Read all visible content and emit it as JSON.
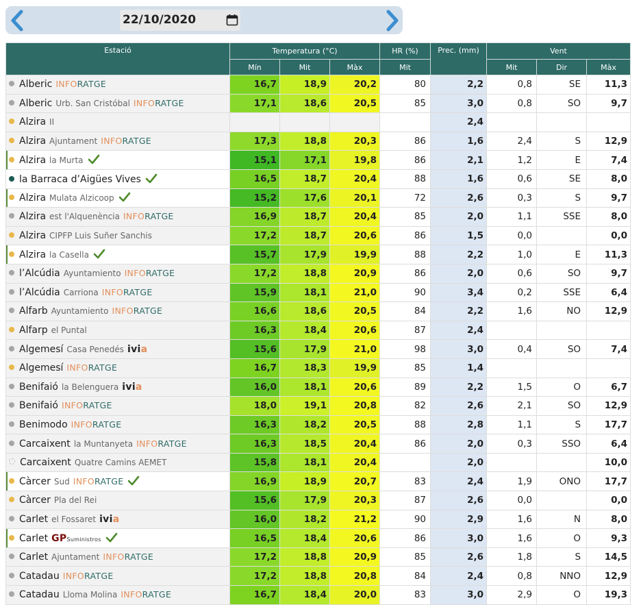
{
  "date_picker": {
    "value": "22/10/2020"
  },
  "nav": {
    "prev_icon": "chevron-left-icon",
    "next_icon": "chevron-right-icon"
  },
  "colors": {
    "header": "#2e6b67",
    "arrow": "#3b8ed0",
    "prec_bg": "#dde6f3",
    "check": "#4d8a2a"
  },
  "table": {
    "group_headers": {
      "station": "Estació",
      "temp": "Temperatura (°C)",
      "hr": "HR (%)",
      "prec": "Prec. (mm)",
      "wind": "Vent"
    },
    "sub_headers": {
      "tmin": "Mín",
      "tmit": "Mit",
      "tmax": "Màx",
      "hrmit": "Mit",
      "wmit": "Mit",
      "wdir": "Dir",
      "wmax": "Màx"
    },
    "rows": [
      {
        "town": "Alberic",
        "sub": "",
        "network": "INFORATGE",
        "dot": "grey",
        "check": false,
        "tmin": "16,7",
        "tmit": "18,9",
        "tmax": "20,2",
        "cmin": "#7ed321",
        "cmit": "#c6ef26",
        "cmax": "#eef524",
        "hr": "80",
        "prec": "2,2",
        "wmit": "0,8",
        "wdir": "SE",
        "wmax": "11,3"
      },
      {
        "town": "Alberic",
        "sub": "Urb. San Cristóbal",
        "network": "INFORATGE",
        "dot": "grey",
        "check": false,
        "tmin": "17,1",
        "tmit": "18,6",
        "tmax": "20,5",
        "cmin": "#8ad92a",
        "cmit": "#b9ea2e",
        "cmax": "#f1f721",
        "hr": "85",
        "prec": "3,0",
        "wmit": "0,8",
        "wdir": "SO",
        "wmax": "9,7"
      },
      {
        "town": "Alzira",
        "sub": "II",
        "network": "",
        "dot": "yellow",
        "check": false,
        "tmin": "",
        "tmit": "",
        "tmax": "",
        "cmin": "",
        "cmit": "",
        "cmax": "",
        "hr": "",
        "prec": "2,4",
        "wmit": "",
        "wdir": "",
        "wmax": ""
      },
      {
        "town": "Alzira",
        "sub": "Ajuntament",
        "network": "INFORATGE",
        "dot": "yellow",
        "check": false,
        "tmin": "17,3",
        "tmit": "18,8",
        "tmax": "20,3",
        "cmin": "#8ed92c",
        "cmit": "#c1ed2a",
        "cmax": "#eff523",
        "hr": "86",
        "prec": "1,6",
        "wmit": "2,4",
        "wdir": "S",
        "wmax": "12,9"
      },
      {
        "town": "Alzira",
        "sub": "la Murta",
        "network": "",
        "dot": "yellow",
        "check": true,
        "marked": true,
        "white": true,
        "tmin": "15,1",
        "tmit": "17,1",
        "tmax": "19,8",
        "cmin": "#3fb824",
        "cmit": "#86d72a",
        "cmax": "#e7f326",
        "hr": "86",
        "prec": "2,1",
        "wmit": "1,2",
        "wdir": "E",
        "wmax": "7,4"
      },
      {
        "town": "la Barraca d’Aigües Vives",
        "sub": "",
        "network": "",
        "dot": "teal",
        "check": true,
        "white": true,
        "tmin": "16,5",
        "tmit": "18,7",
        "tmax": "20,4",
        "cmin": "#78d025",
        "cmit": "#c1ed2a",
        "cmax": "#f0f622",
        "hr": "88",
        "prec": "1,6",
        "wmit": "0,6",
        "wdir": "SE",
        "wmax": "8,0"
      },
      {
        "town": "Alzira",
        "sub": "Mulata Alzicoop",
        "network": "",
        "dot": "yellow",
        "check": true,
        "marked": true,
        "white": true,
        "tmin": "15,2",
        "tmit": "17,6",
        "tmax": "20,1",
        "cmin": "#45ba24",
        "cmit": "#9de02b",
        "cmax": "#ecf424",
        "hr": "72",
        "prec": "2,6",
        "wmit": "0,3",
        "wdir": "S",
        "wmax": "9,7"
      },
      {
        "town": "Alzira",
        "sub": "est l'Alquenència",
        "network": "INFORATGE",
        "dot": "grey",
        "check": false,
        "tmin": "16,9",
        "tmit": "18,7",
        "tmax": "20,4",
        "cmin": "#84d528",
        "cmit": "#bdeb2c",
        "cmax": "#f0f622",
        "hr": "85",
        "prec": "2,0",
        "wmit": "1,1",
        "wdir": "SSE",
        "wmax": "8,0"
      },
      {
        "town": "Alzira",
        "sub": "CIPFP Luis Suñer Sanchis",
        "network": "",
        "dot": "yellow",
        "check": false,
        "tmin": "17,2",
        "tmit": "18,7",
        "tmax": "20,6",
        "cmin": "#8ad92a",
        "cmit": "#bdeb2c",
        "cmax": "#f2f721",
        "hr": "86",
        "prec": "1,5",
        "wmit": "0,0",
        "wdir": "",
        "wmax": "0,0"
      },
      {
        "town": "Alzira",
        "sub": "la Casella",
        "network": "",
        "dot": "yellow",
        "check": true,
        "marked": true,
        "white": true,
        "tmin": "15,7",
        "tmit": "17,9",
        "tmax": "19,9",
        "cmin": "#58c126",
        "cmit": "#a8e42d",
        "cmax": "#e1f127",
        "hr": "88",
        "prec": "2,2",
        "wmit": "1,0",
        "wdir": "E",
        "wmax": "11,3"
      },
      {
        "town": "l’Alcúdia",
        "sub": "Ayuntamiento",
        "network": "INFORATGE",
        "dot": "grey",
        "check": false,
        "tmin": "17,2",
        "tmit": "18,8",
        "tmax": "20,9",
        "cmin": "#8ad92a",
        "cmit": "#c1ed2a",
        "cmax": "#f4f820",
        "hr": "86",
        "prec": "2,0",
        "wmit": "0,6",
        "wdir": "SO",
        "wmax": "9,7"
      },
      {
        "town": "l’Alcúdia",
        "sub": "Carriona",
        "network": "INFORATGE",
        "dot": "grey",
        "check": false,
        "tmin": "15,9",
        "tmit": "18,1",
        "tmax": "21,0",
        "cmin": "#60c427",
        "cmit": "#acE62d",
        "cmax": "#f5f820",
        "hr": "90",
        "prec": "3,4",
        "wmit": "0,2",
        "wdir": "SSE",
        "wmax": "6,4"
      },
      {
        "town": "Alfarb",
        "sub": "Ayuntamiento",
        "network": "INFORATGE",
        "dot": "grey",
        "check": false,
        "tmin": "16,6",
        "tmit": "18,6",
        "tmax": "20,5",
        "cmin": "#7ad126",
        "cmit": "#b9ea2e",
        "cmax": "#f1f721",
        "hr": "84",
        "prec": "2,2",
        "wmit": "1,6",
        "wdir": "NO",
        "wmax": "12,9"
      },
      {
        "town": "Alfarp",
        "sub": "el Puntal",
        "network": "",
        "dot": "yellow",
        "check": false,
        "tmin": "16,3",
        "tmit": "18,4",
        "tmax": "20,6",
        "cmin": "#6ecb26",
        "cmit": "#b4e92d",
        "cmax": "#f2f721",
        "hr": "87",
        "prec": "2,4",
        "wmit": "",
        "wdir": "",
        "wmax": ""
      },
      {
        "town": "Algemesí",
        "sub": "Casa Penedés",
        "network": "ivia",
        "dot": "grey",
        "check": false,
        "tmin": "15,6",
        "tmit": "17,9",
        "tmax": "21,0",
        "cmin": "#54bf25",
        "cmit": "#a8e42d",
        "cmax": "#f5f820",
        "hr": "98",
        "prec": "3,0",
        "wmit": "0,4",
        "wdir": "SO",
        "wmax": "7,4"
      },
      {
        "town": "Algemesí",
        "sub": "",
        "network": "INFORATGE",
        "dot": "yellow",
        "check": false,
        "tmin": "16,7",
        "tmit": "18,3",
        "tmax": "19,9",
        "cmin": "#7ed321",
        "cmit": "#b2e82d",
        "cmax": "#e1f127",
        "hr": "85",
        "prec": "1,4",
        "wmit": "",
        "wdir": "",
        "wmax": ""
      },
      {
        "town": "Benifaió",
        "sub": "la Belenguera",
        "network": "ivia",
        "dot": "grey",
        "check": false,
        "tmin": "16,0",
        "tmit": "18,1",
        "tmax": "20,6",
        "cmin": "#63c526",
        "cmit": "#acE62d",
        "cmax": "#f2f721",
        "hr": "89",
        "prec": "2,2",
        "wmit": "1,5",
        "wdir": "O",
        "wmax": "6,7"
      },
      {
        "town": "Benifaió",
        "sub": "",
        "network": "INFORATGE",
        "dot": "grey",
        "check": false,
        "tmin": "18,0",
        "tmit": "19,1",
        "tmax": "20,8",
        "cmin": "#a6e22b",
        "cmit": "#ccf029",
        "cmax": "#f3f820",
        "hr": "82",
        "prec": "2,6",
        "wmit": "2,1",
        "wdir": "SO",
        "wmax": "12,9"
      },
      {
        "town": "Benimodo",
        "sub": "",
        "network": "INFORATGE",
        "dot": "grey",
        "check": false,
        "tmin": "16,3",
        "tmit": "18,2",
        "tmax": "20,5",
        "cmin": "#6ecb26",
        "cmit": "#b0e72d",
        "cmax": "#f1f721",
        "hr": "88",
        "prec": "2,8",
        "wmit": "1,1",
        "wdir": "S",
        "wmax": "17,7"
      },
      {
        "town": "Carcaixent",
        "sub": "la Muntanyeta",
        "network": "INFORATGE",
        "dot": "grey",
        "check": false,
        "tmin": "16,3",
        "tmit": "18,5",
        "tmax": "20,4",
        "cmin": "#6ecb26",
        "cmit": "#b6e92d",
        "cmax": "#f0f622",
        "hr": "86",
        "prec": "2,0",
        "wmit": "0,3",
        "wdir": "SSO",
        "wmax": "6,4"
      },
      {
        "town": "Carcaixent",
        "sub": "Quatre Camins AEMET",
        "network": "",
        "dot": "hollow",
        "check": false,
        "tmin": "15,8",
        "tmit": "18,1",
        "tmax": "20,4",
        "cmin": "#5dc326",
        "cmit": "#acE62d",
        "cmax": "#f0f622",
        "hr": "",
        "prec": "2,0",
        "wmit": "",
        "wdir": "",
        "wmax": "10,0"
      },
      {
        "town": "Càrcer",
        "sub": "Sud",
        "network": "INFORATGE",
        "dot": "yellow",
        "check": true,
        "marked": true,
        "white": true,
        "tmin": "16,9",
        "tmit": "18,9",
        "tmax": "20,7",
        "cmin": "#84d528",
        "cmit": "#c6ef26",
        "cmax": "#f3f821",
        "hr": "83",
        "prec": "2,4",
        "wmit": "1,9",
        "wdir": "ONO",
        "wmax": "17,7"
      },
      {
        "town": "Càrcer",
        "sub": "Pla del Rei",
        "network": "",
        "dot": "yellow",
        "check": false,
        "tmin": "15,6",
        "tmit": "17,9",
        "tmax": "20,3",
        "cmin": "#54bf25",
        "cmit": "#a8e42d",
        "cmax": "#eff523",
        "hr": "87",
        "prec": "2,6",
        "wmit": "0,0",
        "wdir": "",
        "wmax": "0,0"
      },
      {
        "town": "Carlet",
        "sub": "el Fossaret",
        "network": "ivia",
        "dot": "grey",
        "check": false,
        "tmin": "16,0",
        "tmit": "18,2",
        "tmax": "21,2",
        "cmin": "#63c526",
        "cmit": "#b0e72d",
        "cmax": "#f6f91f",
        "hr": "90",
        "prec": "2,9",
        "wmit": "1,6",
        "wdir": "N",
        "wmax": "8,0"
      },
      {
        "town": "Carlet",
        "sub": "",
        "network": "GP",
        "dot": "yellow",
        "check": true,
        "marked": true,
        "white": true,
        "tmin": "16,5",
        "tmit": "18,4",
        "tmax": "20,6",
        "cmin": "#78d025",
        "cmit": "#b4e92d",
        "cmax": "#f2f721",
        "hr": "86",
        "prec": "3,0",
        "wmit": "1,6",
        "wdir": "O",
        "wmax": "9,3"
      },
      {
        "town": "Carlet",
        "sub": "Ajuntament",
        "network": "INFORATGE",
        "dot": "grey",
        "check": false,
        "tmin": "17,2",
        "tmit": "18,8",
        "tmax": "20,9",
        "cmin": "#8ad92a",
        "cmit": "#c1ed2a",
        "cmax": "#f4f820",
        "hr": "85",
        "prec": "2,6",
        "wmit": "1,8",
        "wdir": "S",
        "wmax": "14,5"
      },
      {
        "town": "Catadau",
        "sub": "",
        "network": "INFORATGE",
        "dot": "grey",
        "check": false,
        "tmin": "17,2",
        "tmit": "18,8",
        "tmax": "20,8",
        "cmin": "#8ad92a",
        "cmit": "#c1ed2a",
        "cmax": "#f3f820",
        "hr": "84",
        "prec": "2,4",
        "wmit": "0,8",
        "wdir": "NNO",
        "wmax": "12,9"
      },
      {
        "town": "Catadau",
        "sub": "Lloma Molina",
        "network": "INFORATGE",
        "dot": "grey",
        "check": false,
        "tmin": "16,7",
        "tmit": "18,4",
        "tmax": "20,0",
        "cmin": "#7ed321",
        "cmit": "#b4e92d",
        "cmax": "#e8f325",
        "hr": "83",
        "prec": "3,0",
        "wmit": "2,9",
        "wdir": "O",
        "wmax": "19,3"
      }
    ]
  }
}
